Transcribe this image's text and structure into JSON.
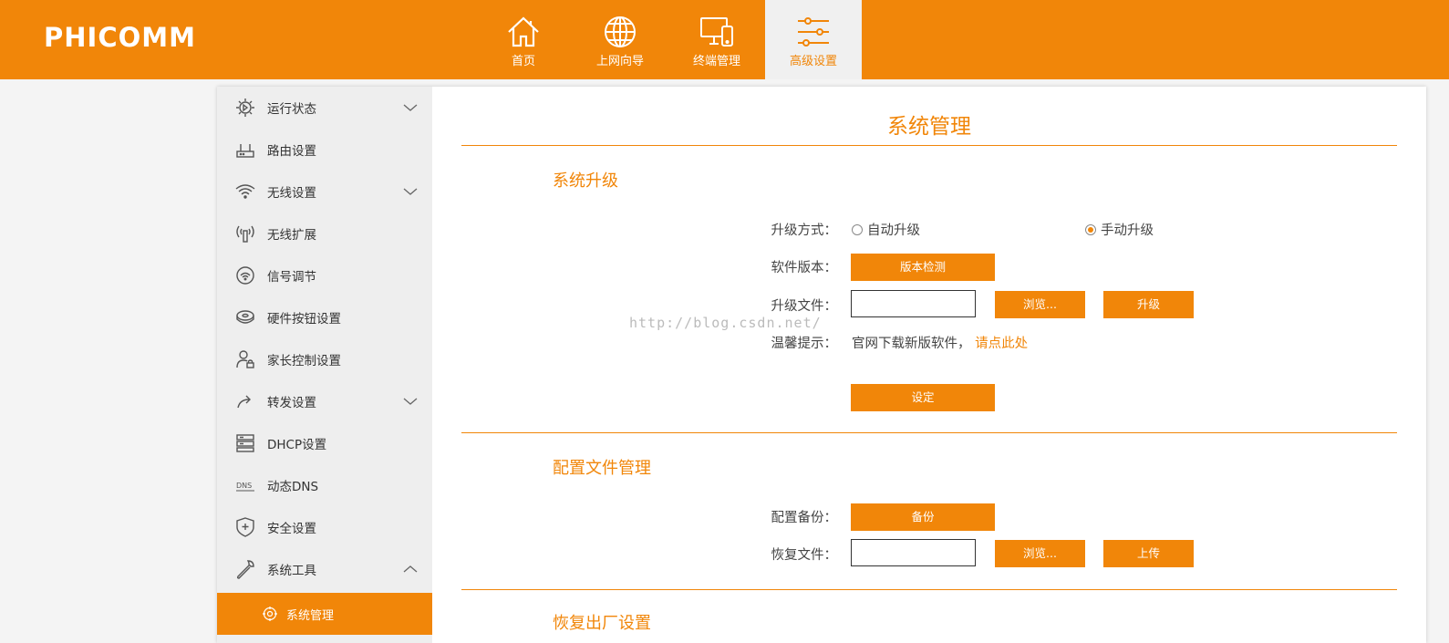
{
  "header": {
    "brand": "PHICOMM",
    "nav": [
      {
        "label": "首页",
        "icon": "home-icon"
      },
      {
        "label": "上网向导",
        "icon": "globe-icon"
      },
      {
        "label": "终端管理",
        "icon": "devices-icon"
      },
      {
        "label": "高级设置",
        "icon": "sliders-icon"
      }
    ],
    "accent": "#f18609"
  },
  "sidebar": {
    "items": [
      {
        "label": "运行状态",
        "icon": "status-gear-icon",
        "expand": "down"
      },
      {
        "label": "路由设置",
        "icon": "router-icon"
      },
      {
        "label": "无线设置",
        "icon": "wifi-icon",
        "expand": "down"
      },
      {
        "label": "无线扩展",
        "icon": "antenna-icon"
      },
      {
        "label": "信号调节",
        "icon": "signal-icon"
      },
      {
        "label": "硬件按钮设置",
        "icon": "hardware-button-icon"
      },
      {
        "label": "家长控制设置",
        "icon": "parental-lock-icon"
      },
      {
        "label": "转发设置",
        "icon": "forward-icon",
        "expand": "down"
      },
      {
        "label": "DHCP设置",
        "icon": "server-icon"
      },
      {
        "label": "动态DNS",
        "icon": "dns-icon"
      },
      {
        "label": "安全设置",
        "icon": "shield-icon"
      },
      {
        "label": "系统工具",
        "icon": "wrench-icon",
        "expand": "up"
      }
    ],
    "active_sub": {
      "label": "系统管理",
      "icon": "target-icon"
    }
  },
  "main": {
    "title": "系统管理",
    "upgrade": {
      "section_title": "系统升级",
      "mode_label": "升级方式：",
      "mode_auto": "自动升级",
      "mode_manual": "手动升级",
      "selected_mode": "manual",
      "version_label": "软件版本：",
      "version_check": "版本检测",
      "file_label": "升级文件：",
      "file_value": "",
      "browse": "浏览...",
      "upgrade_btn": "升级",
      "tip_label": "温馨提示：",
      "tip_text": "官网下载新版软件，",
      "tip_link": "请点此处",
      "set_btn": "设定"
    },
    "config": {
      "section_title": "配置文件管理",
      "backup_label": "配置备份：",
      "backup_btn": "备份",
      "restore_label": "恢复文件：",
      "restore_value": "",
      "browse": "浏览...",
      "upload_btn": "上传"
    },
    "factory": {
      "section_title": "恢复出厂设置"
    },
    "watermark": "http://blog.csdn.net/"
  }
}
